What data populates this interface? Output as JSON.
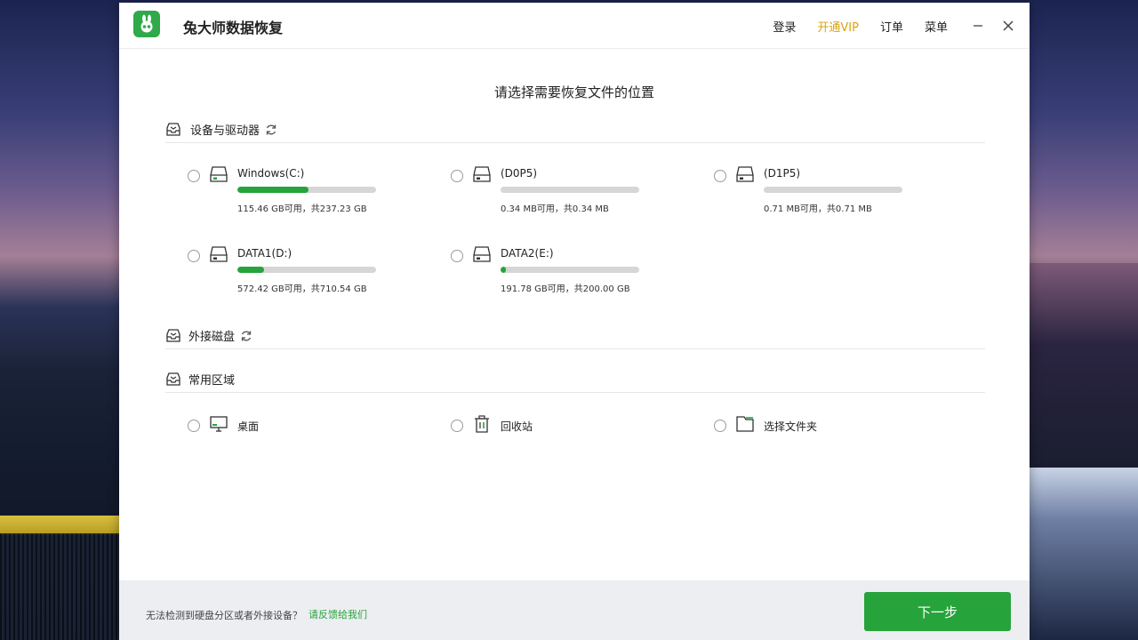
{
  "app": {
    "title": "兔大师数据恢复",
    "menu": {
      "login": "登录",
      "vip": "开通VIP",
      "orders": "订单",
      "menu": "菜单"
    }
  },
  "heading": "请选择需要恢复文件的位置",
  "sections": {
    "devices": "设备与驱动器",
    "external": "外接磁盘",
    "common": "常用区域"
  },
  "drives": [
    {
      "name": "Windows(C:)",
      "size": "115.46 GB可用，共237.23 GB",
      "used_fraction": 0.51
    },
    {
      "name": "(D0P5)",
      "size": "0.34 MB可用，共0.34 MB",
      "used_fraction": 0.0
    },
    {
      "name": "(D1P5)",
      "size": "0.71 MB可用，共0.71 MB",
      "used_fraction": 0.0
    },
    {
      "name": "DATA1(D:)",
      "size": "572.42 GB可用，共710.54 GB",
      "used_fraction": 0.19
    },
    {
      "name": "DATA2(E:)",
      "size": "191.78 GB可用，共200.00 GB",
      "used_fraction": 0.04
    }
  ],
  "common_areas": [
    {
      "label": "桌面",
      "icon": "desktop-icon"
    },
    {
      "label": "回收站",
      "icon": "recycle-bin-icon"
    },
    {
      "label": "选择文件夹",
      "icon": "folder-icon"
    }
  ],
  "footer": {
    "text": "无法检测到硬盘分区或者外接设备？",
    "link": "请反馈给我们",
    "next": "下一步"
  },
  "colors": {
    "accent": "#27a33b",
    "vip": "#d9a313"
  }
}
